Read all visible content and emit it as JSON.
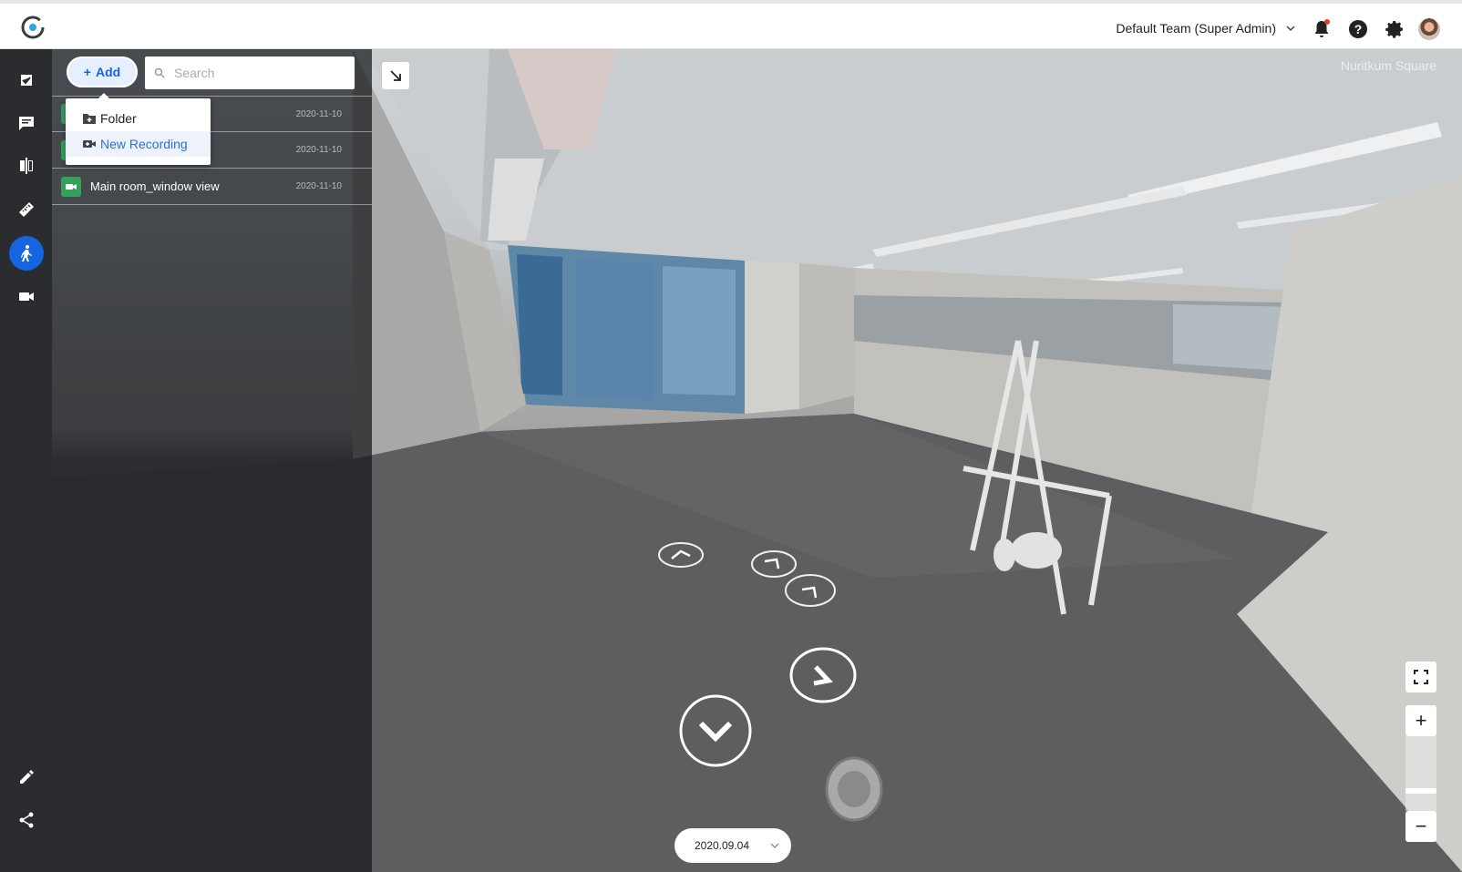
{
  "header": {
    "team_label": "Default Team (Super Admin)",
    "icons": [
      "logo-icon",
      "chevron-down-icon",
      "bell-icon",
      "help-icon",
      "gear-icon",
      "avatar"
    ]
  },
  "rail": {
    "items": [
      "checklist-icon",
      "comment-icon",
      "compare-icon",
      "ruler-icon",
      "walk-icon",
      "video-icon",
      "pencil-icon",
      "share-icon"
    ],
    "active": "walk-icon",
    "active_color": "#1565e0"
  },
  "toolbar": {
    "add_label": "Add",
    "search_placeholder": "Search"
  },
  "add_menu": {
    "items": [
      {
        "label": "Folder"
      },
      {
        "label": "New Recording"
      }
    ]
  },
  "recordings": [
    {
      "name": "",
      "date": "2020-11-10"
    },
    {
      "name": "",
      "date": "2020-11-10"
    },
    {
      "name": "Main room_window view",
      "date": "2020-11-10"
    }
  ],
  "viewer": {
    "place_name": "Nuritkum Square",
    "capture_date": "2020.09.04",
    "zoom_plus": "+",
    "zoom_minus": "−",
    "zoom_level": 0.25
  }
}
